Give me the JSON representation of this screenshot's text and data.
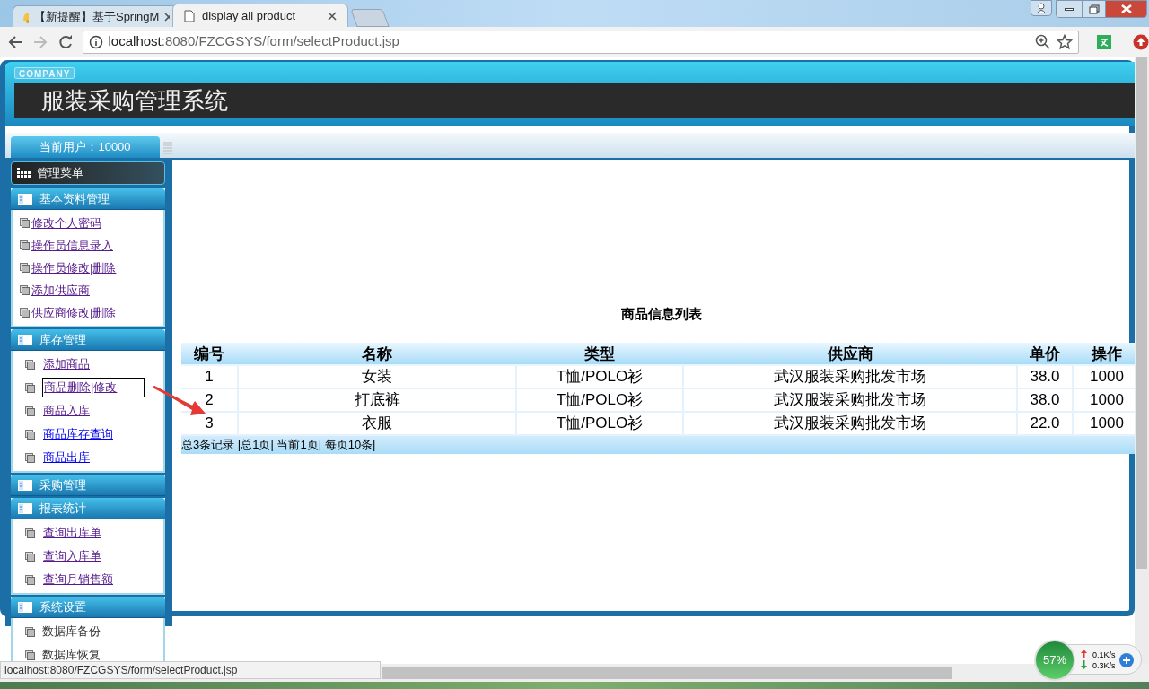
{
  "browser": {
    "tabs": [
      {
        "label": "【新提醒】基于SpringM",
        "selected": false
      },
      {
        "label": "display all product",
        "selected": true
      }
    ],
    "url_host": "localhost",
    "url_path": ":8080/FZCGSYS/form/selectProduct.jsp",
    "status_url": "localhost:8080/FZCGSYS/form/selectProduct.jsp"
  },
  "header": {
    "badge": "COMPANY",
    "title": "服装采购管理系统",
    "user": "当前用户：10000"
  },
  "menu": {
    "title": "管理菜单",
    "sections": [
      {
        "title": "基本资料管理",
        "items": [
          {
            "label": "修改个人密码",
            "kind": "link",
            "visited": true,
            "focused": false
          },
          {
            "label": "操作员信息录入",
            "kind": "link",
            "visited": true,
            "focused": false
          },
          {
            "label": "操作员修改|删除",
            "kind": "link",
            "visited": true,
            "focused": false
          },
          {
            "label": "添加供应商",
            "kind": "link",
            "visited": true,
            "focused": false
          },
          {
            "label": "供应商修改|删除",
            "kind": "link",
            "visited": true,
            "focused": false
          }
        ]
      },
      {
        "title": "库存管理",
        "items": [
          {
            "label": "添加商品",
            "kind": "link",
            "visited": true,
            "focused": false
          },
          {
            "label": "商品删除|修改",
            "kind": "link",
            "visited": true,
            "focused": true
          },
          {
            "label": "商品入库",
            "kind": "link",
            "visited": true,
            "focused": false
          },
          {
            "label": "商品库存查询",
            "kind": "link",
            "visited": false,
            "focused": false
          },
          {
            "label": "商品出库",
            "kind": "link",
            "visited": false,
            "focused": false
          }
        ]
      },
      {
        "title": "采购管理"
      },
      {
        "title": "报表统计",
        "items": [
          {
            "label": "查询出库单",
            "kind": "link",
            "visited": true,
            "focused": false
          },
          {
            "label": "查询入库单",
            "kind": "link",
            "visited": true,
            "focused": false
          },
          {
            "label": "查询月销售额",
            "kind": "link",
            "visited": true,
            "focused": false
          }
        ]
      },
      {
        "title": "系统设置",
        "items": [
          {
            "label": "数据库备份",
            "kind": "text"
          },
          {
            "label": "数据库恢复",
            "kind": "text"
          }
        ]
      }
    ]
  },
  "table": {
    "title": "商品信息列表",
    "columns": [
      "编号",
      "名称",
      "类型",
      "供应商",
      "单价",
      "操作"
    ],
    "rows": [
      [
        "1",
        "女装",
        "T恤/POLO衫",
        "武汉服装采购批发市场",
        "38.0",
        "1000"
      ],
      [
        "2",
        "打底裤",
        "T恤/POLO衫",
        "武汉服装采购批发市场",
        "38.0",
        "1000"
      ],
      [
        "3",
        "衣服",
        "T恤/POLO衫",
        "武汉服装采购批发市场",
        "22.0",
        "1000"
      ]
    ],
    "footer": "总3条记录 |总1页| 当前1页| 每页10条|"
  },
  "net_widget": {
    "percent": "57%",
    "up": "0.1K/s",
    "down": "0.3K/s"
  }
}
